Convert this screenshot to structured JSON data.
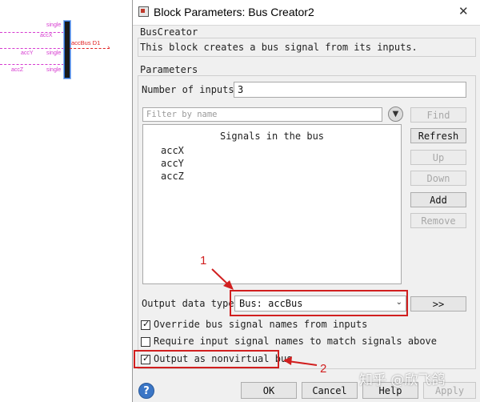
{
  "canvas": {
    "signals": [
      {
        "name": "accX",
        "type": "single"
      },
      {
        "name": "accY",
        "type": "single"
      },
      {
        "name": "accZ",
        "type": "single"
      }
    ],
    "bus_output_label": "accBus D1"
  },
  "dialog": {
    "title": "Block Parameters: Bus Creator2",
    "block_type": "BusCreator",
    "description": "This block creates a bus signal from its inputs.",
    "parameters_header": "Parameters",
    "num_inputs_label": "Number of inputs:",
    "num_inputs_value": "3",
    "filter_placeholder": "Filter by name",
    "signals_header": "Signals in the bus",
    "signals": [
      "accX",
      "accY",
      "accZ"
    ],
    "buttons": {
      "find": "Find",
      "refresh": "Refresh",
      "up": "Up",
      "down": "Down",
      "add": "Add",
      "remove": "Remove",
      "arrow": ">>",
      "ok": "OK",
      "cancel": "Cancel",
      "help": "Help",
      "apply": "Apply"
    },
    "output_data_type_label": "Output data type:",
    "output_data_type_value": "Bus: accBus",
    "checkboxes": [
      {
        "label": "Override bus signal names from inputs",
        "checked": true
      },
      {
        "label": "Require input signal names to match signals above",
        "checked": false
      },
      {
        "label": "Output as nonvirtual bus",
        "checked": true
      }
    ]
  },
  "annotations": {
    "marker_1": "1",
    "marker_2": "2",
    "color": "#d11f1f"
  },
  "watermark": "知乎 @欣飞鸽"
}
